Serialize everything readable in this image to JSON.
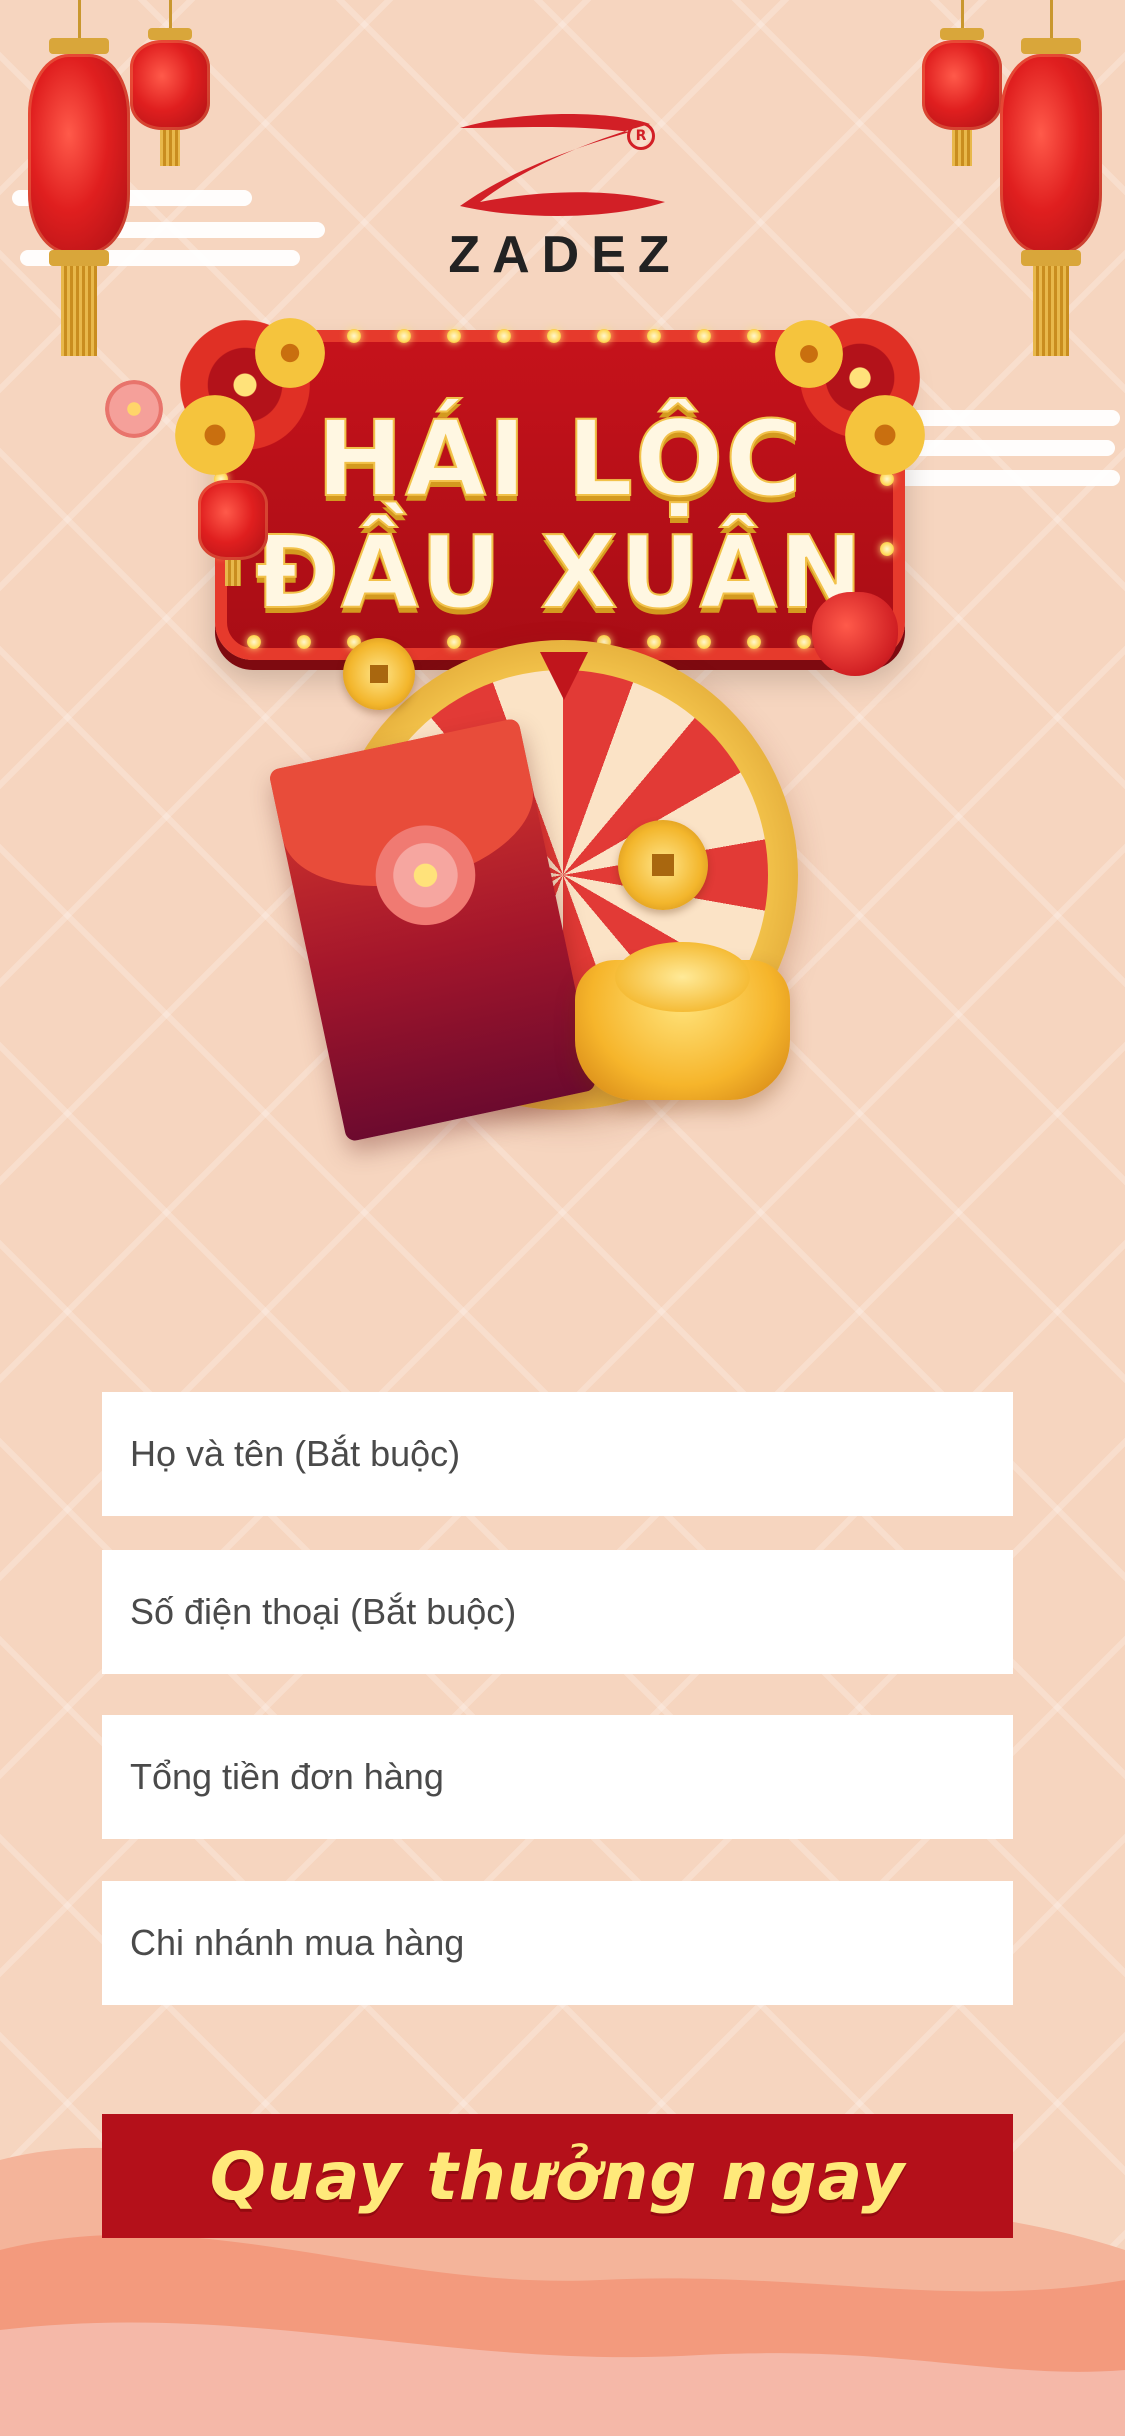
{
  "brand": {
    "name": "ZADEZ",
    "registered_mark": "R"
  },
  "banner": {
    "line1": "HÁI LỘC",
    "line2": "ĐẦU XUÂN"
  },
  "form": {
    "name_placeholder": "Họ và tên (Bắt buộc)",
    "phone_placeholder": "Số điện thoại (Bắt buộc)",
    "order_total_placeholder": "Tổng tiền đơn hàng",
    "branch_placeholder": "Chi nhánh mua hàng"
  },
  "cta": {
    "label": "Quay thưởng ngay"
  },
  "colors": {
    "background": "#f6d5bf",
    "primary_red": "#b4101a",
    "cta_text": "#ffe97a",
    "field_bg": "#ffffff"
  },
  "icons": [
    "lantern-icon",
    "zadez-logo-icon",
    "lucky-wheel-icon",
    "red-envelope-icon",
    "gold-coin-icon",
    "gold-ingot-icon",
    "money-bag-icon",
    "apricot-flower-icon"
  ]
}
